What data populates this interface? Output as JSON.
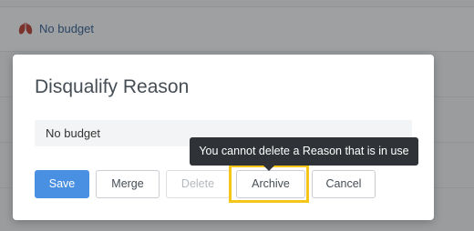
{
  "background_list": {
    "first_row_label": "No budget",
    "first_row_icon": "lungs-icon"
  },
  "modal": {
    "title": "Disqualify Reason",
    "name_value": "No budget",
    "buttons": {
      "save": "Save",
      "merge": "Merge",
      "delete": "Delete",
      "archive": "Archive",
      "cancel": "Cancel"
    }
  },
  "tooltip": {
    "text": "You cannot delete a Reason that is in use"
  },
  "colors": {
    "primary": "#4a90e2",
    "highlight": "#f5c518",
    "tooltip_bg": "#2f3337",
    "icon_red": "#c0392b"
  }
}
